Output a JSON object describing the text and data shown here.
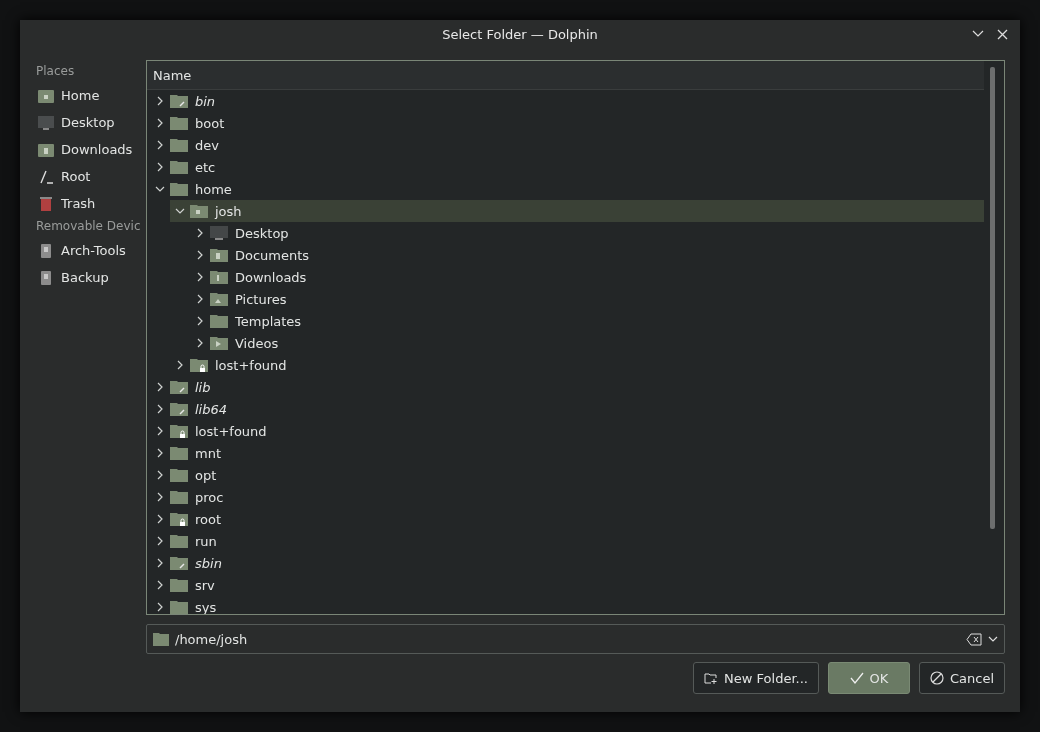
{
  "window": {
    "title": "Select Folder — Dolphin"
  },
  "sidebar": [
    {
      "heading": "Places",
      "items": [
        {
          "label": "Home",
          "kind": "home"
        },
        {
          "label": "Desktop",
          "kind": "desktop"
        },
        {
          "label": "Downloads",
          "kind": "downloads"
        },
        {
          "label": "Root",
          "kind": "root"
        },
        {
          "label": "Trash",
          "kind": "trash"
        }
      ]
    },
    {
      "heading": "Removable Devic",
      "items": [
        {
          "label": "Arch-Tools",
          "kind": "drive"
        },
        {
          "label": "Backup",
          "kind": "drive"
        }
      ]
    }
  ],
  "tree": {
    "column": "Name",
    "items": [
      {
        "name": "bin",
        "kind": "symlink",
        "expanded": false,
        "selected": false
      },
      {
        "name": "boot",
        "kind": "folder",
        "expanded": false,
        "selected": false
      },
      {
        "name": "dev",
        "kind": "folder",
        "expanded": false,
        "selected": false
      },
      {
        "name": "etc",
        "kind": "folder",
        "expanded": false,
        "selected": false
      },
      {
        "name": "home",
        "kind": "folder",
        "expanded": true,
        "selected": false,
        "children": [
          {
            "name": "josh",
            "kind": "home",
            "expanded": true,
            "selected": true,
            "children": [
              {
                "name": "Desktop",
                "kind": "desktop",
                "expanded": false,
                "selected": false
              },
              {
                "name": "Documents",
                "kind": "documents",
                "expanded": false,
                "selected": false
              },
              {
                "name": "Downloads",
                "kind": "downloads",
                "expanded": false,
                "selected": false
              },
              {
                "name": "Pictures",
                "kind": "pictures",
                "expanded": false,
                "selected": false
              },
              {
                "name": "Templates",
                "kind": "folder",
                "expanded": false,
                "selected": false
              },
              {
                "name": "Videos",
                "kind": "videos",
                "expanded": false,
                "selected": false
              }
            ]
          },
          {
            "name": "lost+found",
            "kind": "locked",
            "expanded": false,
            "selected": false
          }
        ]
      },
      {
        "name": "lib",
        "kind": "symlink",
        "expanded": false,
        "selected": false
      },
      {
        "name": "lib64",
        "kind": "symlink",
        "expanded": false,
        "selected": false
      },
      {
        "name": "lost+found",
        "kind": "locked",
        "expanded": false,
        "selected": false
      },
      {
        "name": "mnt",
        "kind": "folder",
        "expanded": false,
        "selected": false
      },
      {
        "name": "opt",
        "kind": "folder",
        "expanded": false,
        "selected": false
      },
      {
        "name": "proc",
        "kind": "folder",
        "expanded": false,
        "selected": false
      },
      {
        "name": "root",
        "kind": "locked",
        "expanded": false,
        "selected": false
      },
      {
        "name": "run",
        "kind": "folder",
        "expanded": false,
        "selected": false
      },
      {
        "name": "sbin",
        "kind": "symlink",
        "expanded": false,
        "selected": false
      },
      {
        "name": "srv",
        "kind": "folder",
        "expanded": false,
        "selected": false
      },
      {
        "name": "sys",
        "kind": "folder",
        "expanded": false,
        "selected": false
      }
    ]
  },
  "location": {
    "value": "/home/josh"
  },
  "buttons": [
    {
      "label": "New Folder...",
      "kind": "new-folder",
      "primary": false
    },
    {
      "label": "OK",
      "kind": "ok",
      "primary": true
    },
    {
      "label": "Cancel",
      "kind": "cancel",
      "primary": false
    }
  ]
}
